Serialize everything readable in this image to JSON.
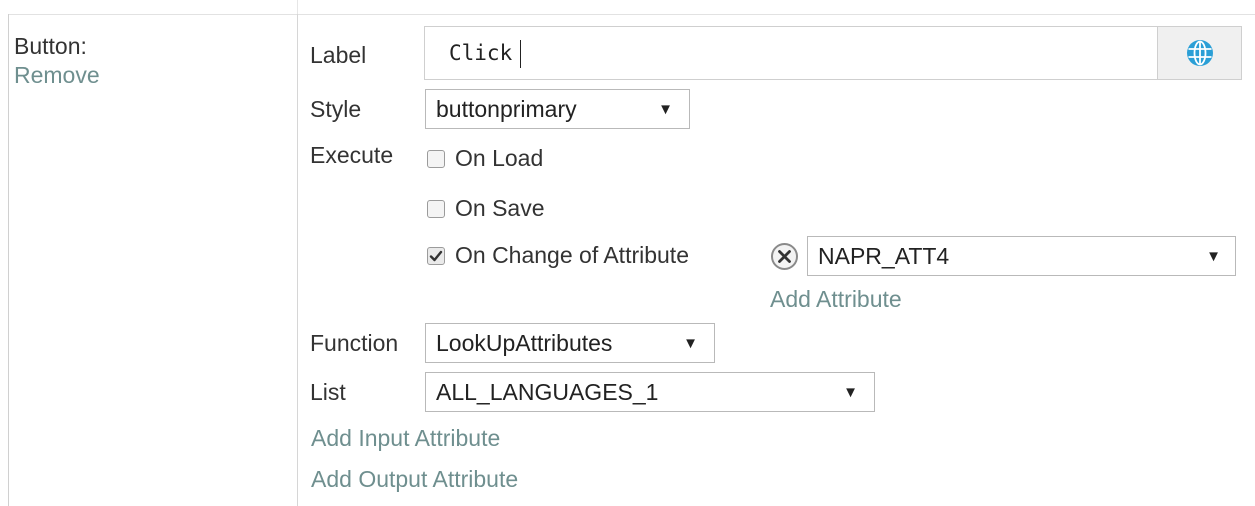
{
  "left_panel": {
    "title": "Button:",
    "remove_link": "Remove"
  },
  "form": {
    "label": {
      "caption": "Label",
      "value": "Click",
      "globe_icon": "globe-icon"
    },
    "style": {
      "caption": "Style",
      "selected": "buttonprimary"
    },
    "execute": {
      "caption": "Execute",
      "on_load": {
        "label": "On Load",
        "checked": false
      },
      "on_save": {
        "label": "On Save",
        "checked": false
      },
      "on_change": {
        "label": "On Change of Attribute",
        "checked": true
      },
      "attribute_selected": "NAPR_ATT4",
      "add_attribute": "Add Attribute"
    },
    "function": {
      "caption": "Function",
      "selected": "LookUpAttributes"
    },
    "list": {
      "caption": "List",
      "selected": "ALL_LANGUAGES_1"
    },
    "add_input_attribute": "Add Input Attribute",
    "add_output_attribute": "Add Output Attribute"
  },
  "colors": {
    "link": "#6f8f8f",
    "globe": "#2b9fd6",
    "border": "#b9b9b9"
  }
}
